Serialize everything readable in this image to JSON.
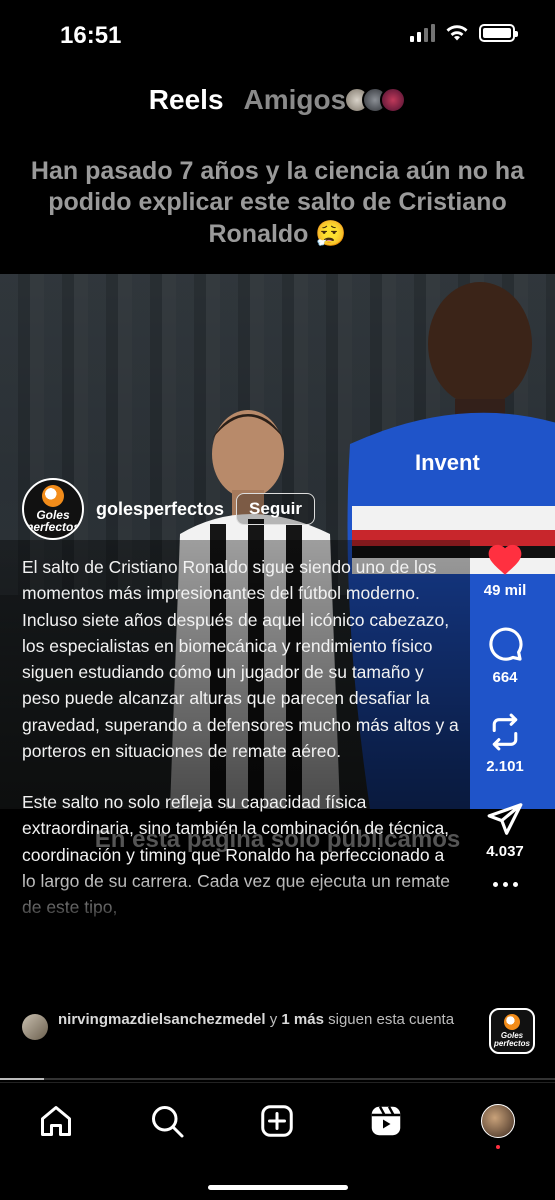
{
  "status_bar": {
    "time": "16:51"
  },
  "header": {
    "tabs": [
      {
        "label": "Reels",
        "active": true
      },
      {
        "label": "Amigos",
        "active": false
      }
    ]
  },
  "reel": {
    "overlay_title": "Han pasado 7 años y la ciencia aún no ha podido explicar este salto de Cristiano Ronaldo 😮‍💨",
    "video_bottom_text": "En esta página solo publicamos",
    "account": {
      "username": "golesperfectos",
      "avatar_text": "Goles perfectos",
      "follow_label": "Seguir"
    },
    "caption": {
      "paragraph_1": "El salto de Cristiano Ronaldo sigue siendo uno de los momentos más impresionantes del fútbol moderno. Incluso siete años después de aquel icónico cabezazo, los especialistas en biomecánica y rendimiento físico siguen estudiando cómo un jugador de su tamaño y peso puede alcanzar alturas que parecen desafiar la gravedad, superando a defensores mucho más altos y a porteros en situaciones de remate aéreo.",
      "paragraph_2": "Este salto no solo refleja su capacidad física extraordinaria, sino también la combinación de técnica, coordinación y timing que Ronaldo ha perfeccionado a lo largo de su carrera. Cada vez que ejecuta un remate de este tipo,"
    },
    "followers": {
      "name": "nirvingmazdielsanchezmedel",
      "connector": " y ",
      "others": "1 más",
      "suffix": " siguen esta cuenta"
    },
    "actions": {
      "likes": "49 mil",
      "comments": "664",
      "reposts": "2.101",
      "shares": "4.037"
    },
    "audio_thumb_text": "Goles perfectos",
    "progress": 0.08
  },
  "colors": {
    "like": "#ff3040",
    "background": "#000000",
    "inactive_tab": "#8a8a8a"
  },
  "bottom_nav": {
    "items": [
      "home-icon",
      "search-icon",
      "create-icon",
      "reels-icon",
      "profile"
    ]
  }
}
